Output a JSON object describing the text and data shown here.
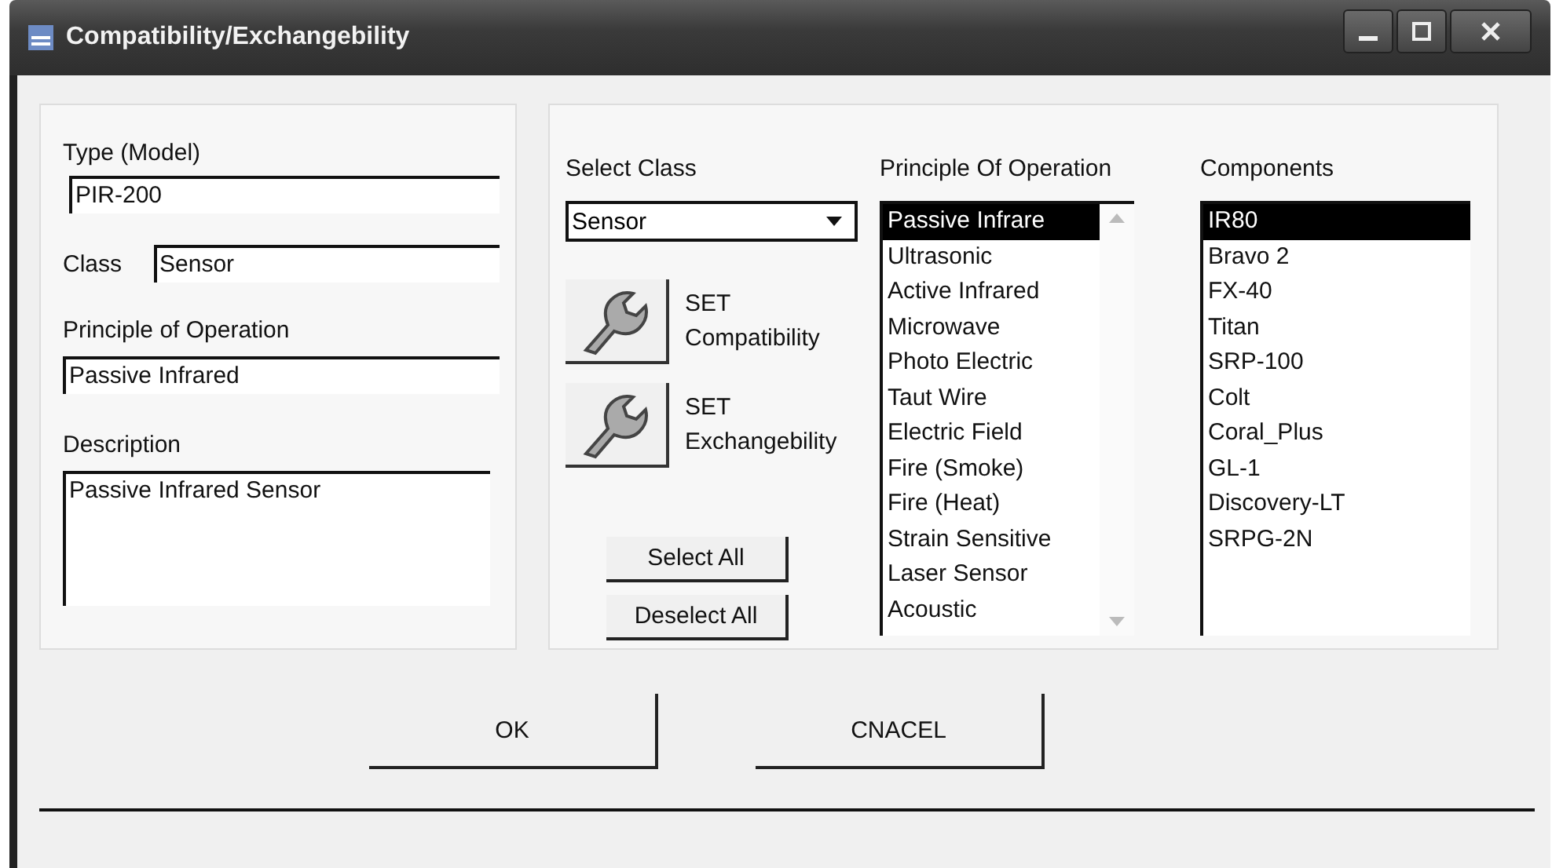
{
  "window": {
    "title": "Compatibility/Exchangebility"
  },
  "details": {
    "type_label": "Type (Model)",
    "type_value": "PIR-200",
    "class_label": "Class",
    "class_value": "Sensor",
    "principle_label": "Principle of Operation",
    "principle_value": "Passive Infrared",
    "description_label": "Description",
    "description_value": "Passive Infrared Sensor"
  },
  "select_class": {
    "label": "Select Class",
    "value": "Sensor"
  },
  "tool_buttons": [
    {
      "line1": "SET",
      "line2": "Compatibility"
    },
    {
      "line1": "SET",
      "line2": "Exchangebility"
    }
  ],
  "select_buttons": [
    "Select All",
    "Deselect All"
  ],
  "principle_list": {
    "header": "Principle Of Operation",
    "items": [
      {
        "label": "Passive Infrare",
        "selected": true
      },
      {
        "label": "Ultrasonic",
        "selected": false
      },
      {
        "label": "Active Infrared",
        "selected": false
      },
      {
        "label": "Microwave",
        "selected": false
      },
      {
        "label": "Photo Electric",
        "selected": false
      },
      {
        "label": "Taut Wire",
        "selected": false
      },
      {
        "label": "Electric Field",
        "selected": false
      },
      {
        "label": "Fire (Smoke)",
        "selected": false
      },
      {
        "label": "Fire (Heat)",
        "selected": false
      },
      {
        "label": "Strain Sensitive",
        "selected": false
      },
      {
        "label": "Laser Sensor",
        "selected": false
      },
      {
        "label": "Acoustic",
        "selected": false
      }
    ]
  },
  "components_list": {
    "header": "Components",
    "items": [
      {
        "label": "IR80",
        "selected": true
      },
      {
        "label": "Bravo 2",
        "selected": false
      },
      {
        "label": "FX-40",
        "selected": false
      },
      {
        "label": "Titan",
        "selected": false
      },
      {
        "label": "SRP-100",
        "selected": false
      },
      {
        "label": "Colt",
        "selected": false
      },
      {
        "label": "Coral_Plus",
        "selected": false
      },
      {
        "label": "GL-1",
        "selected": false
      },
      {
        "label": "Discovery-LT",
        "selected": false
      },
      {
        "label": "SRPG-2N",
        "selected": false
      }
    ]
  },
  "buttons": [
    "OK",
    "CNACEL"
  ]
}
